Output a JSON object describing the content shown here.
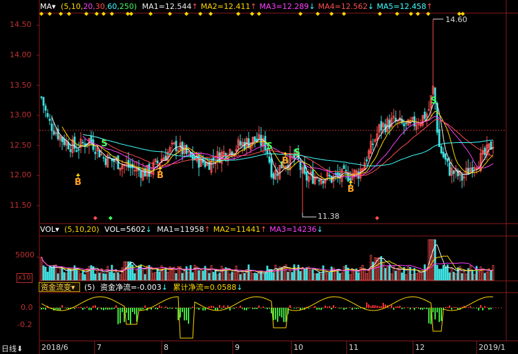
{
  "indicator_main": {
    "name": "MA",
    "params_open": "(",
    "params": [
      "5",
      "10",
      "20",
      "30",
      "60",
      "250"
    ],
    "params_close": ")",
    "ma": [
      {
        "label": "MA1=12.544",
        "arrow": "↑",
        "color": "#f0f0f0"
      },
      {
        "label": "MA2=12.411",
        "arrow": "↑",
        "color": "#ffd800"
      },
      {
        "label": "MA3=12.289",
        "arrow": "↓",
        "color": "#ff40ff"
      },
      {
        "label": "MA4=12.562",
        "arrow": "↓",
        "color": "#ff5050"
      },
      {
        "label": "MA5=12.458",
        "arrow": "↑",
        "color": "#40ffff"
      }
    ]
  },
  "price_axis": [
    "14.50",
    "14.00",
    "13.50",
    "13.00",
    "12.50",
    "12.00",
    "11.50"
  ],
  "annotations": {
    "high": "14.60",
    "low": "11.38"
  },
  "signals": {
    "buy": "B",
    "sell": "S"
  },
  "indicator_vol": {
    "name": "VOL",
    "params": "(5,10,20)",
    "vol": "VOL=5602",
    "vol_arrow": "↓",
    "ma": [
      {
        "label": "MA1=11958",
        "arrow": "↑",
        "color": "#f0f0f0"
      },
      {
        "label": "MA2=11441",
        "arrow": "↑",
        "color": "#ffd800"
      },
      {
        "label": "MA3=14236",
        "arrow": "↓",
        "color": "#ff40ff"
      }
    ],
    "axis": "5000",
    "unit": "x10"
  },
  "indicator_flow": {
    "dropdown": "资金流变",
    "dropdown_arrow": "▾",
    "params": "(5)",
    "net": "资金净流=-0.003",
    "net_arrow": "↓",
    "cum": "累计净流=0.0588",
    "cum_arrow": "↓",
    "axis": [
      "0.0",
      "-0.2"
    ]
  },
  "time_axis": [
    "2018/6",
    "7",
    "8",
    "9",
    "10",
    "11",
    "12",
    "2019/1"
  ],
  "bottom_tab": "日线",
  "bottom_tab_arrow": "⬇",
  "colors": {
    "up": "#ff5050",
    "down": "#40e0e0",
    "grid": "#8b1a1a",
    "text_red": "#c03030"
  }
}
